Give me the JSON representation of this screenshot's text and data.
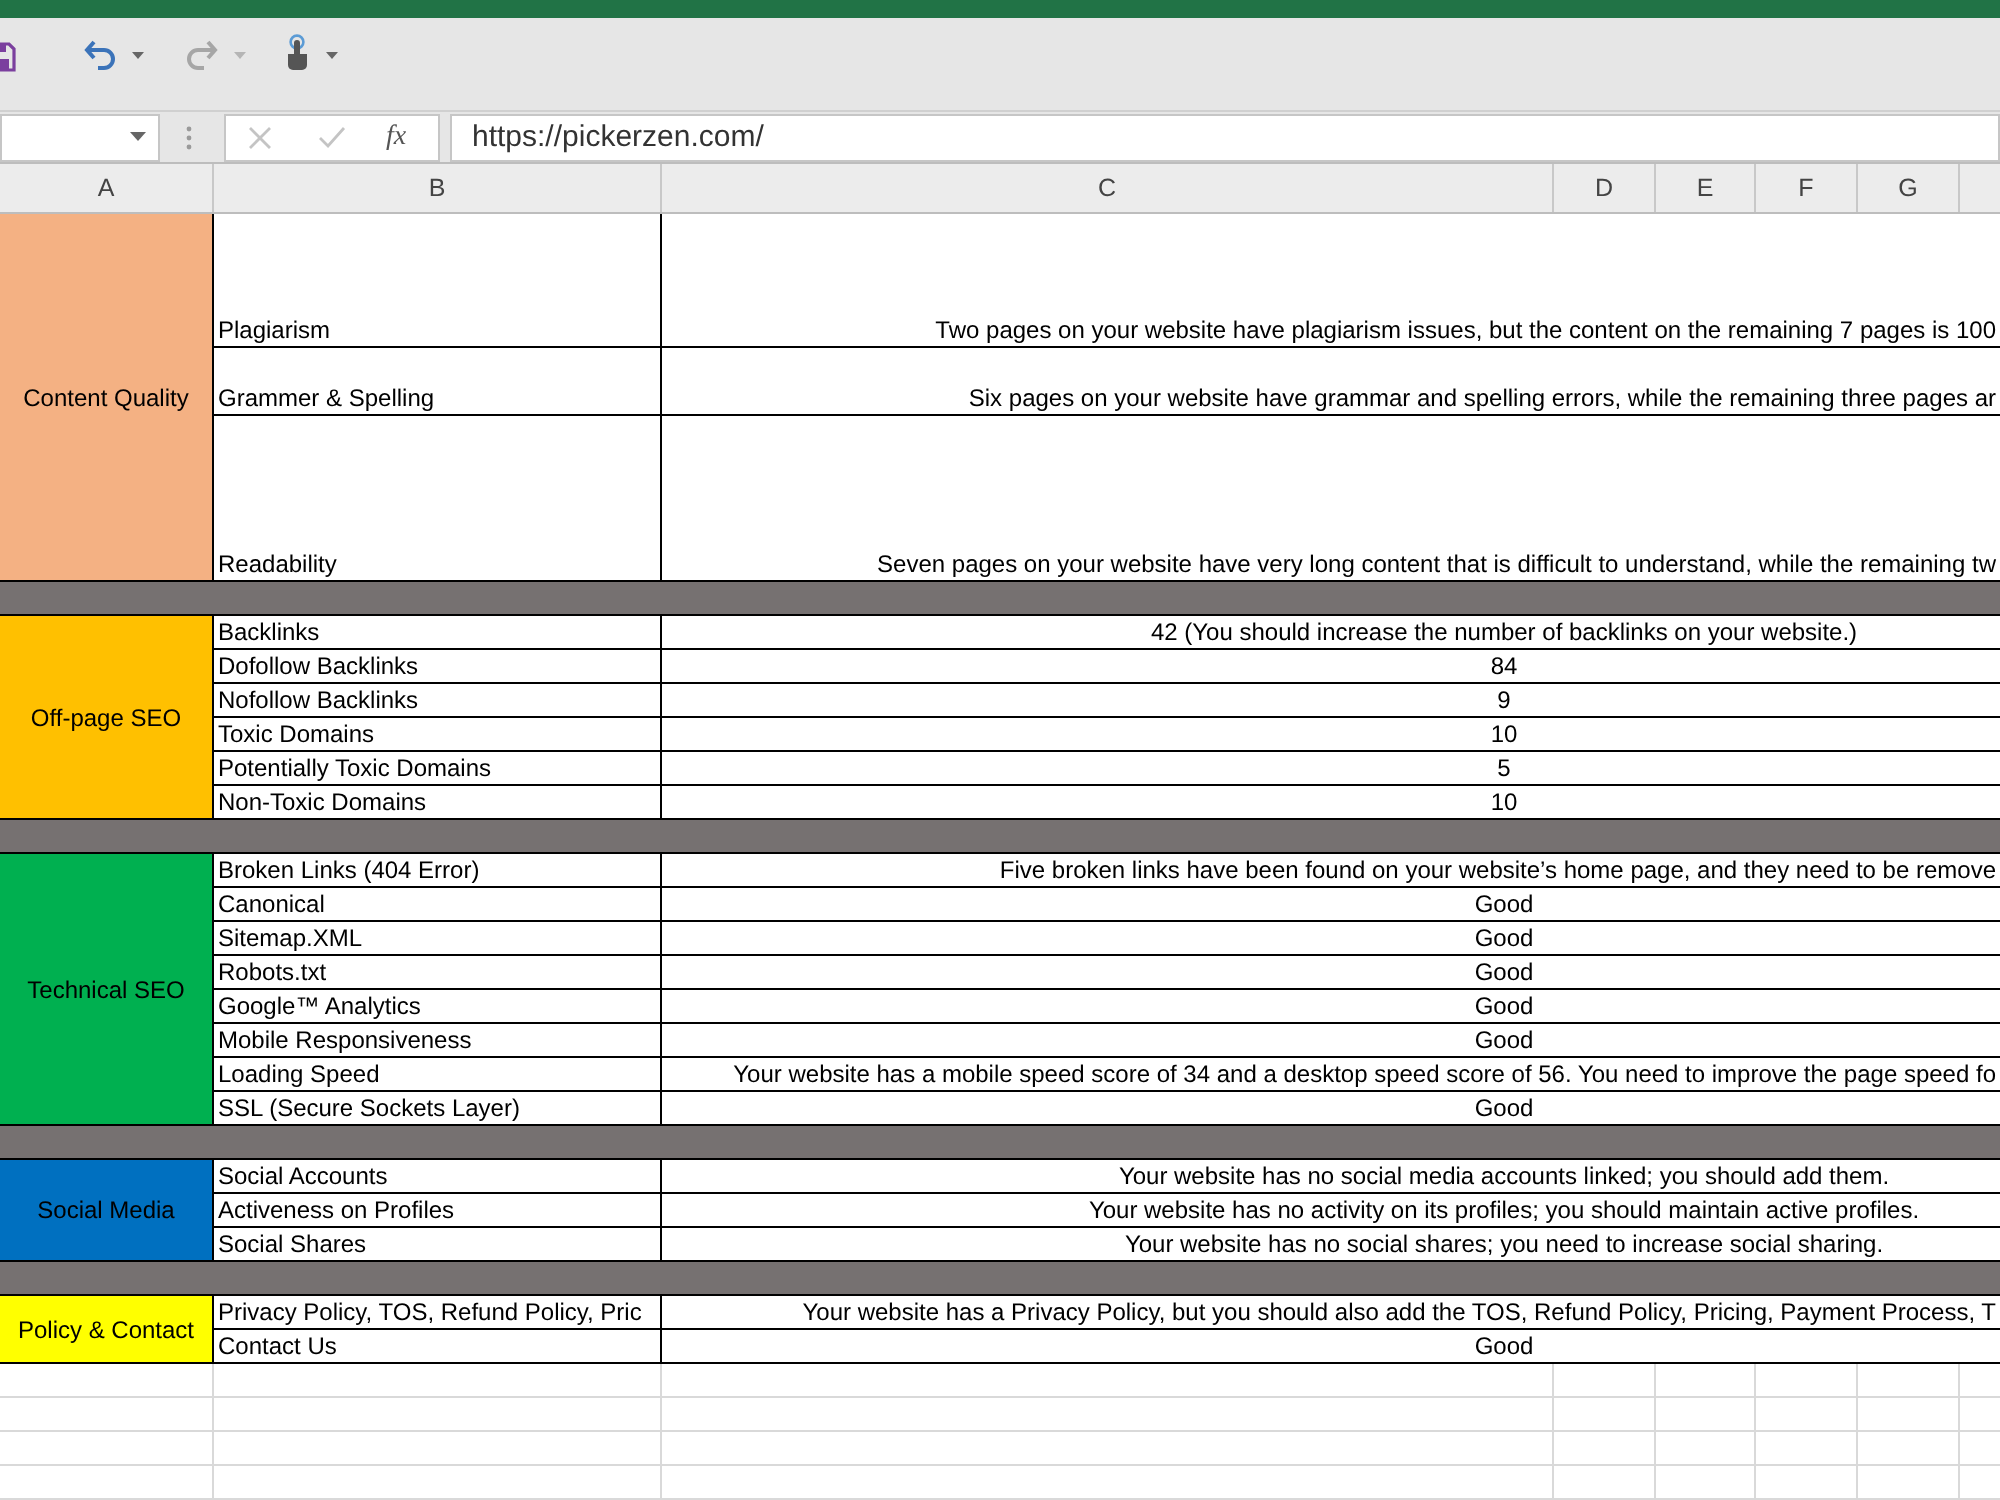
{
  "quick_access_toolbar": {
    "undo_disabled": false,
    "redo_disabled": true
  },
  "formula_bar": {
    "cancel_disabled": true,
    "enter_disabled": true,
    "function_label": "fx",
    "value": "https://pickerzen.com/"
  },
  "columns": [
    "A",
    "B",
    "C",
    "D",
    "E",
    "F",
    "G"
  ],
  "groups": [
    {
      "category": "Content Quality",
      "color": "#f4b183",
      "rows": [
        {
          "metric": "Plagiarism",
          "result": "Two pages on your website have plagiarism issues, but the content on the remaining 7 pages is 100"
        },
        {
          "metric": "Grammer & Spelling",
          "result": "Six pages on your website have grammar and spelling errors, while the remaining three pages ar"
        },
        {
          "metric": "Readability",
          "result": "Seven pages on your website have very long content that is difficult to understand, while the remaining tw"
        }
      ]
    },
    {
      "category": "Off-page SEO",
      "color": "#ffc000",
      "rows": [
        {
          "metric": "Backlinks",
          "result": "42 (You should increase the number of backlinks on your website.)"
        },
        {
          "metric": "Dofollow Backlinks",
          "result": "84"
        },
        {
          "metric": "Nofollow Backlinks",
          "result": "9"
        },
        {
          "metric": "Toxic Domains",
          "result": "10"
        },
        {
          "metric": "Potentially Toxic Domains",
          "result": "5"
        },
        {
          "metric": "Non-Toxic Domains",
          "result": "10"
        }
      ]
    },
    {
      "category": "Technical SEO",
      "color": "#00b050",
      "rows": [
        {
          "metric": "Broken Links (404 Error)",
          "result": "Five broken links have been found on your website’s home page, and they need to be remove"
        },
        {
          "metric": "Canonical",
          "result": "Good"
        },
        {
          "metric": "Sitemap.XML",
          "result": "Good"
        },
        {
          "metric": "Robots.txt",
          "result": "Good"
        },
        {
          "metric": "Google™ Analytics",
          "result": "Good"
        },
        {
          "metric": "Mobile Responsiveness",
          "result": "Good"
        },
        {
          "metric": "Loading Speed",
          "result": "Your website has a mobile speed score of 34 and a desktop speed score of 56. You need to improve the page speed fo"
        },
        {
          "metric": "SSL (Secure Sockets Layer)",
          "result": "Good"
        }
      ]
    },
    {
      "category": "Social Media",
      "color": "#0070c0",
      "rows": [
        {
          "metric": "Social Accounts",
          "result": "Your website has no social media accounts linked; you should add them."
        },
        {
          "metric": "Activeness on Profiles",
          "result": "Your website has no activity on its profiles; you should maintain active profiles."
        },
        {
          "metric": "Social Shares",
          "result": "Your website has no social shares; you need to increase social sharing."
        }
      ]
    },
    {
      "category": "Policy & Contact",
      "color": "#ffff00",
      "rows": [
        {
          "metric": "Privacy Policy, TOS, Refund Policy, Pric",
          "result": "Your website has a Privacy Policy, but you should also add the TOS, Refund Policy, Pricing, Payment Process, T"
        },
        {
          "metric": "Contact Us",
          "result": "Good"
        }
      ]
    }
  ]
}
